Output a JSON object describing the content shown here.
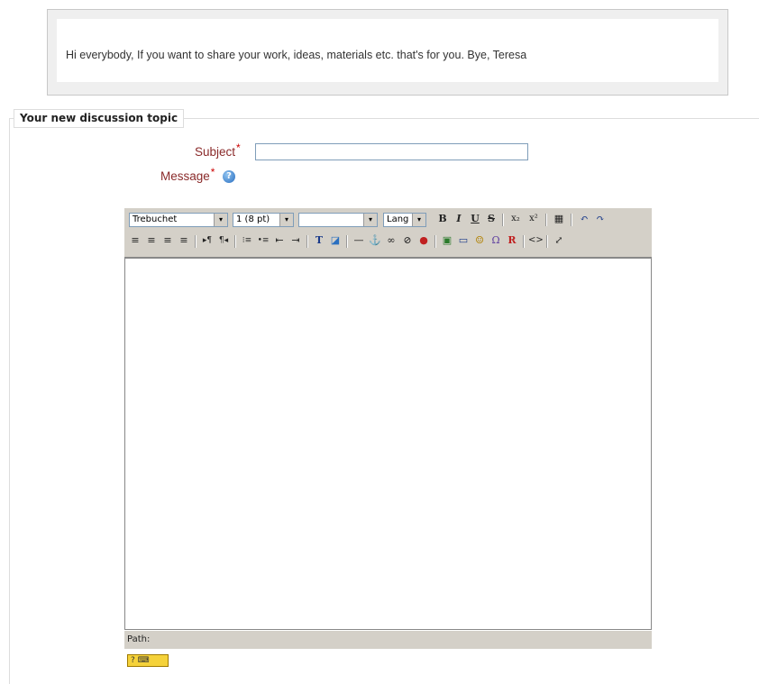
{
  "intro": {
    "text": "Hi everybody, If you want to share your work, ideas, materials etc. that's for you. Bye, Teresa"
  },
  "form": {
    "legend": "Your new discussion topic",
    "subject_label": "Subject",
    "message_label": "Message",
    "required_mark": "*",
    "subject_value": "",
    "help_icon": "?"
  },
  "editor": {
    "font_family": "Trebuchet",
    "font_size": "1 (8 pt)",
    "format": "",
    "lang": "Lang",
    "path_label": "Path:",
    "dropdown_arrow": "▾",
    "toolbar_row1": {
      "bold": "B",
      "italic": "I",
      "underline": "U",
      "strikethrough": "S",
      "subscript": "x₂",
      "superscript": "x²",
      "paste_word": "▦",
      "undo": "↶",
      "redo": "↷"
    },
    "toolbar_row2": {
      "align_left": "≡",
      "align_center": "≡",
      "align_right": "≡",
      "justify": "≡",
      "ltr": "▸¶",
      "rtl": "¶◂",
      "ordered_list": "⁝≡",
      "unordered_list": "•≡",
      "outdent": "⇤",
      "indent": "⇥",
      "text_color": "T",
      "bg_color": "◪",
      "hr": "—",
      "anchor": "⚓",
      "link": "∞",
      "unlink": "⊘",
      "nolink": "●",
      "image": "▣",
      "table": "▭",
      "smiley": "☺",
      "special_char": "Ω",
      "find_replace": "R",
      "html_source": "<>",
      "fullscreen": "⤢"
    },
    "keyboard_button": "? ⌨"
  }
}
